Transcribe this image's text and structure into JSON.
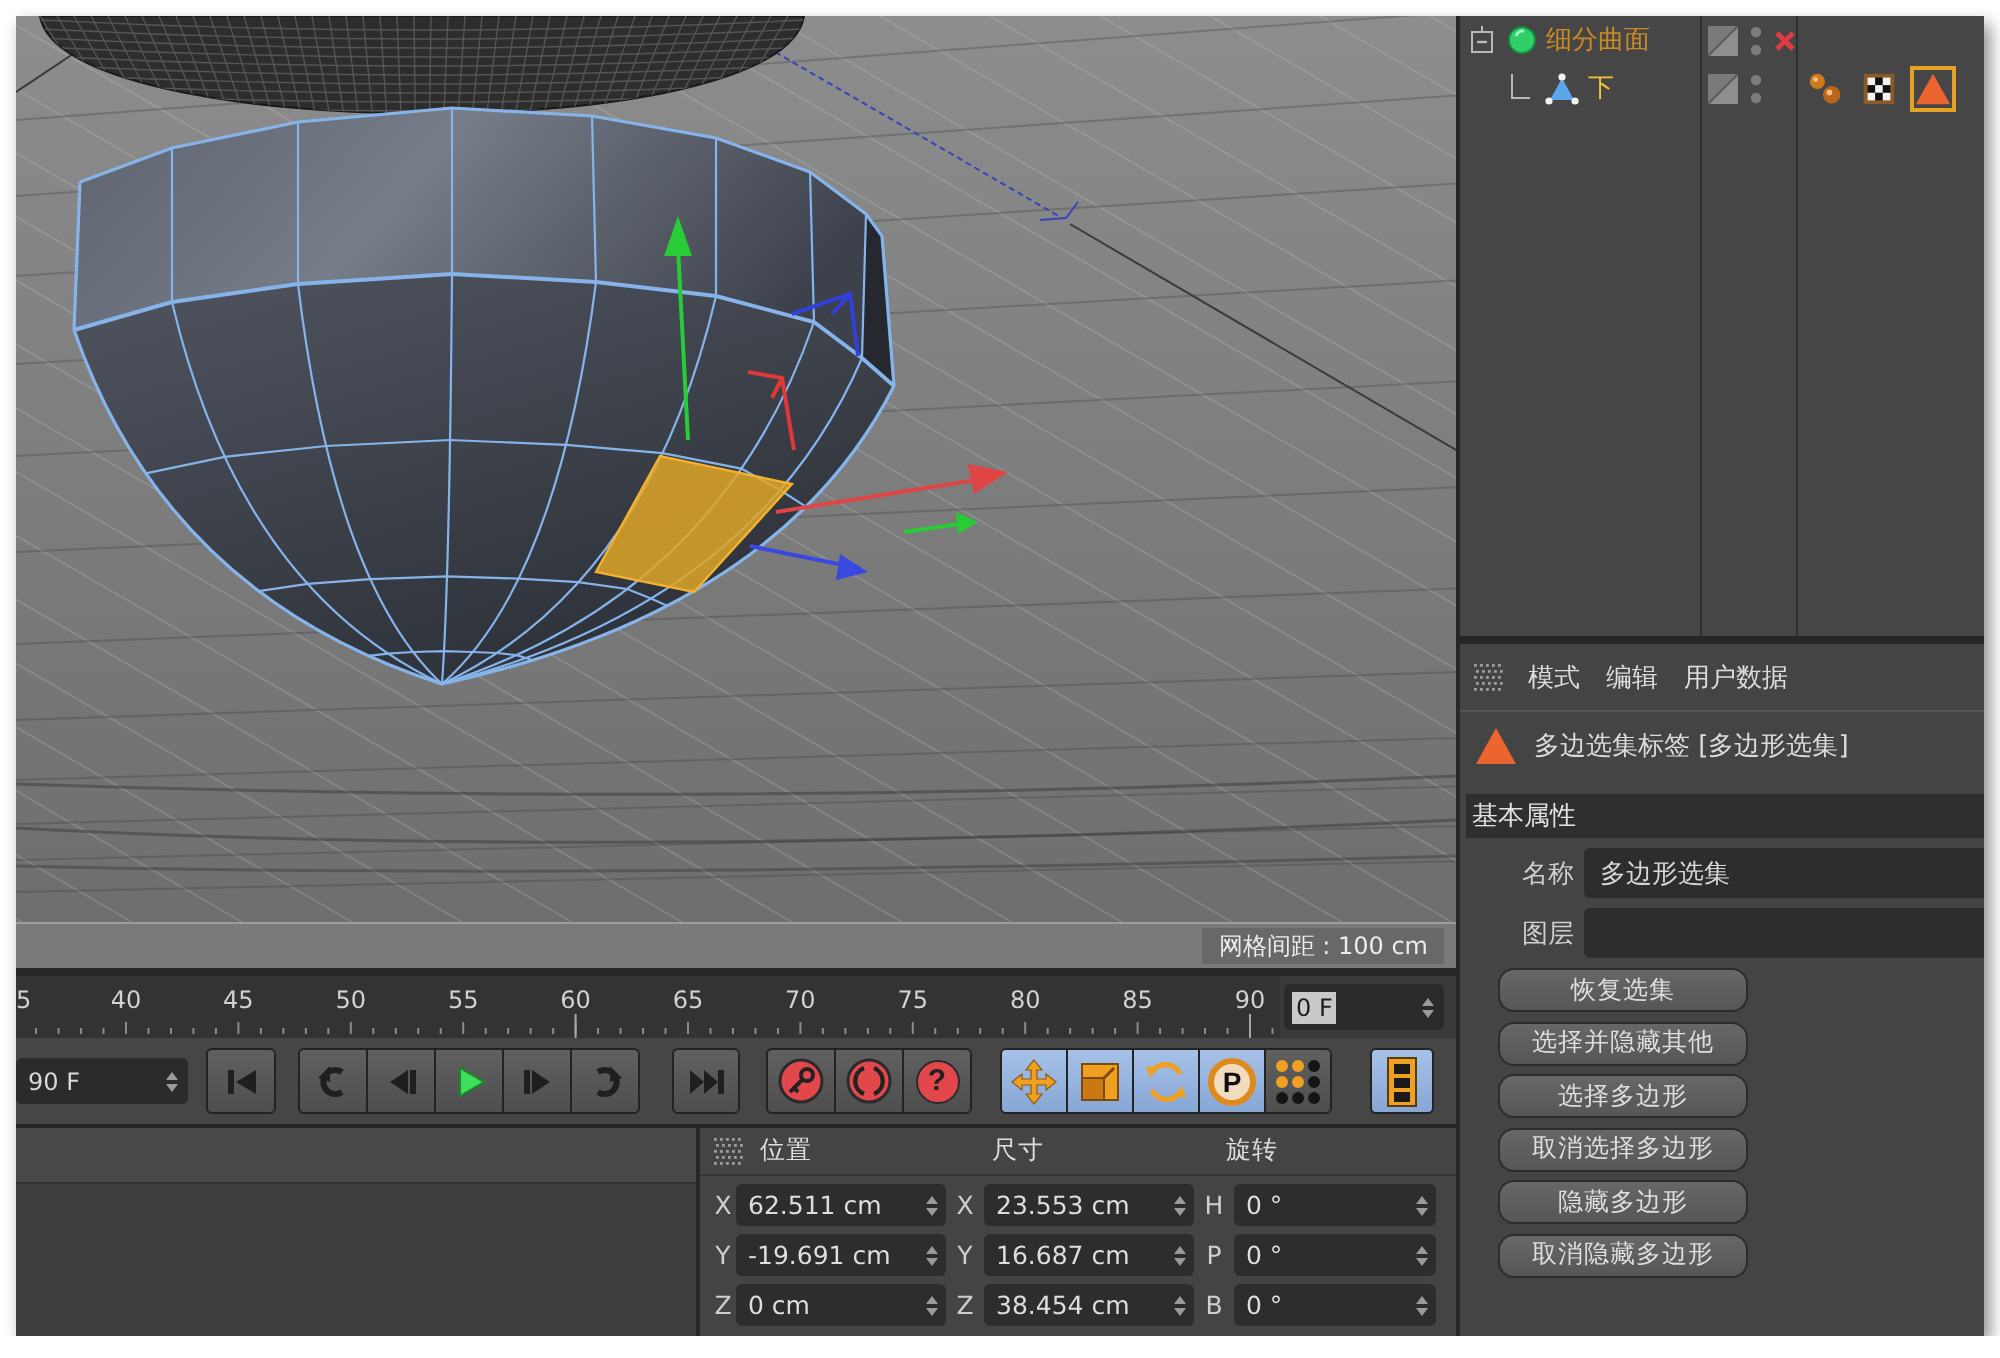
{
  "viewport": {
    "grid_spacing": "网格间距 : 100 cm"
  },
  "timeline": {
    "ruler_labels": [
      "5",
      "40",
      "45",
      "50",
      "55",
      "60",
      "65",
      "70",
      "75",
      "80",
      "85",
      "90"
    ],
    "current_frame": "0 F"
  },
  "playback": {
    "end_frame": "90 F",
    "transport": [
      {
        "kind": "start"
      },
      {
        "kind": "prev-key"
      },
      {
        "kind": "prev-frame"
      },
      {
        "kind": "play"
      },
      {
        "kind": "next-frame"
      },
      {
        "kind": "next-key"
      },
      {
        "kind": "end"
      }
    ],
    "record": [
      {
        "kind": "record"
      },
      {
        "kind": "autokey"
      },
      {
        "kind": "help",
        "glyph": "?"
      }
    ],
    "toggles": [
      {
        "kind": "move",
        "on": true
      },
      {
        "kind": "scale",
        "on": true
      },
      {
        "kind": "rotate",
        "on": true
      },
      {
        "kind": "param",
        "glyph": "P",
        "on": true
      },
      {
        "kind": "points",
        "on": false
      }
    ],
    "timeline_button": {
      "on": true
    }
  },
  "coordinates": {
    "headers": [
      "位置",
      "尺寸",
      "旋转"
    ],
    "rows": [
      [
        {
          "axis": "X",
          "value": "62.511 cm"
        },
        {
          "axis": "X",
          "value": "23.553 cm"
        },
        {
          "axis": "H",
          "value": "0 °"
        }
      ],
      [
        {
          "axis": "Y",
          "value": "-19.691 cm"
        },
        {
          "axis": "Y",
          "value": "16.687 cm"
        },
        {
          "axis": "P",
          "value": "0 °"
        }
      ],
      [
        {
          "axis": "Z",
          "value": "0 cm"
        },
        {
          "axis": "Z",
          "value": "38.454 cm"
        },
        {
          "axis": "B",
          "value": "0 °"
        }
      ]
    ]
  },
  "object_manager": {
    "objects": [
      {
        "name": "细分曲面",
        "kind": "generator",
        "expanded": true,
        "selected": true,
        "active": false,
        "enabled": false,
        "children": [
          {
            "name": "下",
            "kind": "mesh",
            "selected": true,
            "active": true,
            "tags": [
              {
                "kind": "phong",
                "selected": false
              },
              {
                "kind": "uvw",
                "selected": false
              },
              {
                "kind": "selection",
                "selected": true
              }
            ]
          }
        ]
      }
    ]
  },
  "attributes": {
    "menu": [
      "模式",
      "编辑",
      "用户数据"
    ],
    "title": "多边选集标签 [多边形选集]",
    "section": "基本属性",
    "fields": [
      {
        "label": "名称",
        "value": "多边形选集"
      },
      {
        "label": "图层"
      }
    ],
    "buttons": [
      "恢复选集",
      "选择并隐藏其他",
      "选择多边形",
      "取消选择多边形",
      "隐藏多边形",
      "取消隐藏多边形"
    ]
  }
}
